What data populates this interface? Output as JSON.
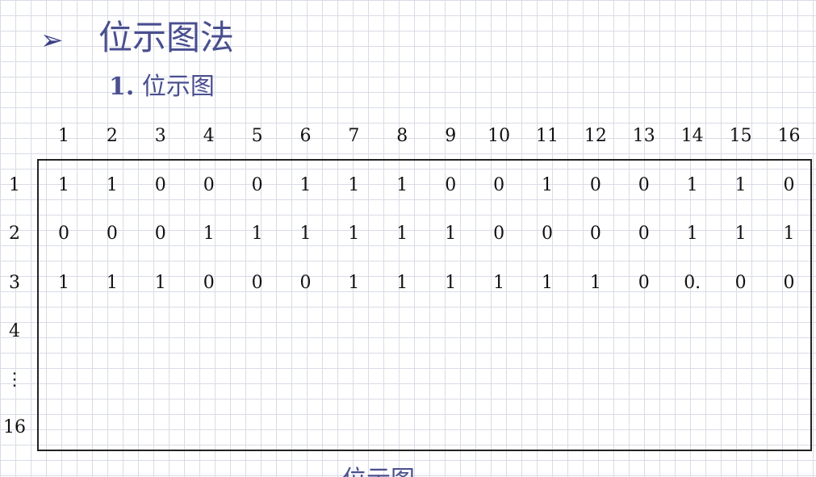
{
  "slide": {
    "bullet_icon": "arrow-bullet-icon",
    "bullet_glyph": "➢",
    "heading": "位示图法",
    "subheading_number": "1.",
    "subheading_text": "位示图",
    "caption": "位示图"
  },
  "bitmap": {
    "column_headers": [
      "1",
      "2",
      "3",
      "4",
      "5",
      "6",
      "7",
      "8",
      "9",
      "10",
      "11",
      "12",
      "13",
      "14",
      "15",
      "16"
    ],
    "row_headers": [
      "1",
      "2",
      "3",
      "4",
      "⋮",
      "16"
    ],
    "rows": [
      [
        "1",
        "1",
        "0",
        "0",
        "0",
        "1",
        "1",
        "1",
        "0",
        "0",
        "1",
        "0",
        "0",
        "1",
        "1",
        "0"
      ],
      [
        "0",
        "0",
        "0",
        "1",
        "1",
        "1",
        "1",
        "1",
        "1",
        "0",
        "0",
        "0",
        "0",
        "1",
        "1",
        "1"
      ],
      [
        "1",
        "1",
        "1",
        "0",
        "0",
        "0",
        "1",
        "1",
        "1",
        "1",
        "1",
        "1",
        "0",
        "0.",
        "0",
        "0"
      ]
    ]
  }
}
